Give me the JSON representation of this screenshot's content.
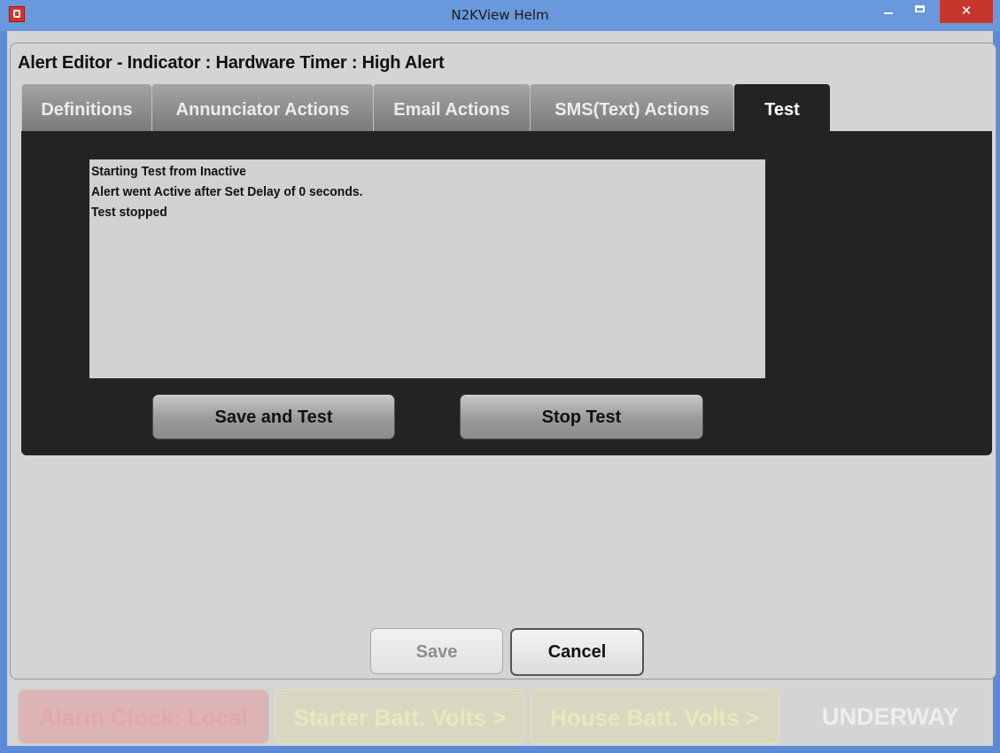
{
  "window": {
    "title": "N2KView Helm"
  },
  "dialog": {
    "title": "Alert Editor - Indicator : Hardware Timer : High Alert"
  },
  "tabs": [
    {
      "label": "Definitions"
    },
    {
      "label": "Annunciator Actions"
    },
    {
      "label": "Email Actions"
    },
    {
      "label": "SMS(Text) Actions"
    },
    {
      "label": "Test",
      "active": true
    }
  ],
  "log": {
    "lines": [
      "Starting Test from Inactive",
      "Alert went Active after Set Delay of 0 seconds.",
      "Test stopped"
    ]
  },
  "test_buttons": {
    "save_and_test": "Save and Test",
    "stop_test": "Stop Test"
  },
  "footer": {
    "save": "Save",
    "cancel": "Cancel"
  },
  "status_bar": {
    "items": [
      {
        "label": "Alarm Clock: Local",
        "color": "#dcb4b4"
      },
      {
        "label": "Starter Batt. Volts >",
        "color": "#d8d8c2"
      },
      {
        "label": "House Batt. Volts >",
        "color": "#d8d8c2"
      }
    ],
    "mode": "UNDERWAY"
  }
}
